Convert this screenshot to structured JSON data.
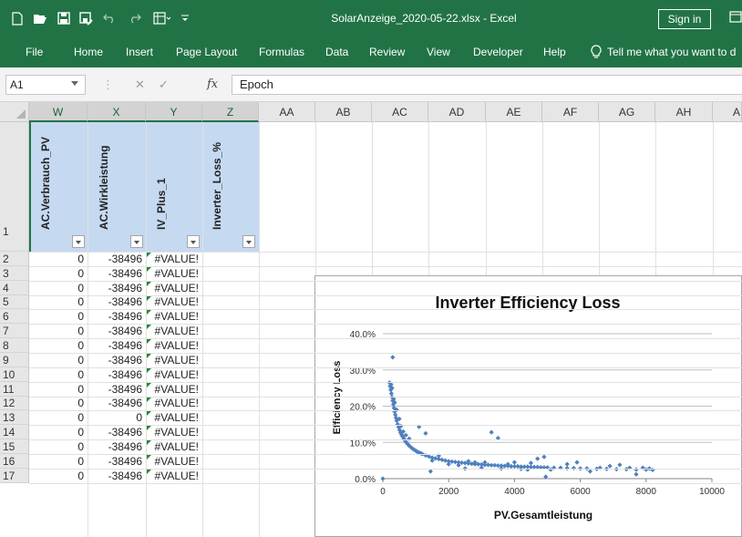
{
  "titlebar": {
    "document_title": "SolarAnzeige_2020-05-22.xlsx - Excel",
    "sign_in_label": "Sign in",
    "quick_access_icons": [
      "new-document-icon",
      "open-folder-icon",
      "save-icon",
      "save-as-icon",
      "undo-icon",
      "redo-icon",
      "form-icon",
      "customize-qat-icon"
    ],
    "colors": {
      "excel_green": "#217346"
    }
  },
  "ribbon": {
    "tabs": [
      "File",
      "Home",
      "Insert",
      "Page Layout",
      "Formulas",
      "Data",
      "Review",
      "View",
      "Developer",
      "Help"
    ],
    "tell_me": "Tell me what you want to d"
  },
  "formula_bar": {
    "name_box": "A1",
    "fx_label": "fx",
    "content": "Epoch"
  },
  "sheet": {
    "columns": [
      "W",
      "X",
      "Y",
      "Z",
      "AA",
      "AB",
      "AC",
      "AD",
      "AE",
      "AF",
      "AG",
      "AH",
      "A"
    ],
    "selected_columns": [
      "W",
      "X",
      "Y",
      "Z"
    ],
    "header_row": {
      "row_number": "1",
      "cells": [
        "AC.Verbrauch_PV",
        "AC.Wirkleistung",
        "IV_Plus_1",
        "Inverter_Loss_%"
      ]
    },
    "rows": [
      {
        "n": "2",
        "w": "0",
        "x": "-38496",
        "y": "#VALUE!"
      },
      {
        "n": "3",
        "w": "0",
        "x": "-38496",
        "y": "#VALUE!"
      },
      {
        "n": "4",
        "w": "0",
        "x": "-38496",
        "y": "#VALUE!"
      },
      {
        "n": "5",
        "w": "0",
        "x": "-38496",
        "y": "#VALUE!"
      },
      {
        "n": "6",
        "w": "0",
        "x": "-38496",
        "y": "#VALUE!"
      },
      {
        "n": "7",
        "w": "0",
        "x": "-38496",
        "y": "#VALUE!"
      },
      {
        "n": "8",
        "w": "0",
        "x": "-38496",
        "y": "#VALUE!"
      },
      {
        "n": "9",
        "w": "0",
        "x": "-38496",
        "y": "#VALUE!"
      },
      {
        "n": "10",
        "w": "0",
        "x": "-38496",
        "y": "#VALUE!"
      },
      {
        "n": "11",
        "w": "0",
        "x": "-38496",
        "y": "#VALUE!"
      },
      {
        "n": "12",
        "w": "0",
        "x": "-38496",
        "y": "#VALUE!"
      },
      {
        "n": "13",
        "w": "0",
        "x": "0",
        "y": "#VALUE!"
      },
      {
        "n": "14",
        "w": "0",
        "x": "-38496",
        "y": "#VALUE!"
      },
      {
        "n": "15",
        "w": "0",
        "x": "-38496",
        "y": "#VALUE!"
      },
      {
        "n": "16",
        "w": "0",
        "x": "-38496",
        "y": "#VALUE!"
      },
      {
        "n": "17",
        "w": "0",
        "x": "-38496",
        "y": "#VALUE!"
      }
    ]
  },
  "chart_data": {
    "type": "scatter",
    "title": "Inverter Efficiency Loss",
    "xlabel": "PV.Gesamtleistung",
    "ylabel": "Efficiency Loss",
    "xlim": [
      0,
      10000
    ],
    "ylim": [
      0,
      0.4
    ],
    "x_ticks": [
      "0",
      "2000",
      "4000",
      "6000",
      "8000",
      "10000"
    ],
    "y_ticks": [
      "0.0%",
      "10.0%",
      "20.0%",
      "30.0%",
      "40.0%"
    ],
    "grid": "horizontal",
    "marker": "diamond",
    "marker_color": "#4f81bd",
    "series": [
      {
        "points": [
          [
            0,
            0.0
          ],
          [
            200,
            0.265
          ],
          [
            220,
            0.255
          ],
          [
            240,
            0.245
          ],
          [
            260,
            0.235
          ],
          [
            280,
            0.225
          ],
          [
            300,
            0.215
          ],
          [
            320,
            0.205
          ],
          [
            340,
            0.195
          ],
          [
            360,
            0.185
          ],
          [
            380,
            0.176
          ],
          [
            400,
            0.168
          ],
          [
            420,
            0.16
          ],
          [
            450,
            0.15
          ],
          [
            480,
            0.142
          ],
          [
            510,
            0.134
          ],
          [
            540,
            0.127
          ],
          [
            570,
            0.121
          ],
          [
            600,
            0.116
          ],
          [
            640,
            0.11
          ],
          [
            680,
            0.104
          ],
          [
            720,
            0.099
          ],
          [
            760,
            0.095
          ],
          [
            800,
            0.091
          ],
          [
            850,
            0.087
          ],
          [
            900,
            0.083
          ],
          [
            950,
            0.08
          ],
          [
            1000,
            0.077
          ],
          [
            1050,
            0.074
          ],
          [
            1100,
            0.072
          ],
          [
            1150,
            0.07
          ],
          [
            1200,
            0.068
          ],
          [
            1300,
            0.064
          ],
          [
            1400,
            0.061
          ],
          [
            1500,
            0.058
          ],
          [
            1600,
            0.056
          ],
          [
            1700,
            0.054
          ],
          [
            1800,
            0.052
          ],
          [
            1900,
            0.05
          ],
          [
            2000,
            0.048
          ],
          [
            2100,
            0.047
          ],
          [
            2200,
            0.046
          ],
          [
            2300,
            0.045
          ],
          [
            2400,
            0.044
          ],
          [
            2500,
            0.043
          ],
          [
            2600,
            0.042
          ],
          [
            2700,
            0.041
          ],
          [
            2800,
            0.04
          ],
          [
            2900,
            0.04
          ],
          [
            3000,
            0.039
          ],
          [
            3100,
            0.038
          ],
          [
            3200,
            0.038
          ],
          [
            3300,
            0.037
          ],
          [
            3400,
            0.037
          ],
          [
            3500,
            0.036
          ],
          [
            3600,
            0.036
          ],
          [
            3700,
            0.035
          ],
          [
            3800,
            0.035
          ],
          [
            3900,
            0.034
          ],
          [
            4000,
            0.034
          ],
          [
            4100,
            0.034
          ],
          [
            4200,
            0.033
          ],
          [
            4300,
            0.033
          ],
          [
            4400,
            0.033
          ],
          [
            4500,
            0.032
          ],
          [
            4600,
            0.032
          ],
          [
            4700,
            0.032
          ],
          [
            4800,
            0.031
          ],
          [
            4900,
            0.031
          ],
          [
            5000,
            0.031
          ],
          [
            5200,
            0.03
          ],
          [
            5400,
            0.03
          ],
          [
            5600,
            0.029
          ],
          [
            5800,
            0.029
          ],
          [
            6000,
            0.028
          ],
          [
            6200,
            0.028
          ],
          [
            6500,
            0.027
          ],
          [
            6800,
            0.027
          ],
          [
            7100,
            0.026
          ],
          [
            7400,
            0.026
          ],
          [
            7700,
            0.025
          ],
          [
            8000,
            0.025
          ],
          [
            8200,
            0.024
          ],
          [
            300,
            0.335
          ],
          [
            250,
            0.26
          ],
          [
            280,
            0.25
          ],
          [
            330,
            0.22
          ],
          [
            360,
            0.21
          ],
          [
            420,
            0.19
          ],
          [
            500,
            0.165
          ],
          [
            550,
            0.145
          ],
          [
            620,
            0.13
          ],
          [
            700,
            0.12
          ],
          [
            800,
            0.11
          ],
          [
            1100,
            0.143
          ],
          [
            1300,
            0.125
          ],
          [
            1500,
            0.05
          ],
          [
            1450,
            0.02
          ],
          [
            1700,
            0.063
          ],
          [
            2000,
            0.04
          ],
          [
            2300,
            0.037
          ],
          [
            2600,
            0.048
          ],
          [
            3000,
            0.03
          ],
          [
            3300,
            0.128
          ],
          [
            3500,
            0.112
          ],
          [
            3800,
            0.04
          ],
          [
            4200,
            0.027
          ],
          [
            4500,
            0.043
          ],
          [
            4700,
            0.055
          ],
          [
            4900,
            0.06
          ],
          [
            4950,
            0.005
          ],
          [
            5100,
            0.025
          ],
          [
            5600,
            0.04
          ],
          [
            5900,
            0.045
          ],
          [
            6300,
            0.02
          ],
          [
            6600,
            0.03
          ],
          [
            6900,
            0.035
          ],
          [
            7200,
            0.038
          ],
          [
            7500,
            0.03
          ],
          [
            7700,
            0.012
          ],
          [
            7900,
            0.03
          ],
          [
            8100,
            0.028
          ],
          [
            2500,
            0.028
          ],
          [
            2800,
            0.045
          ],
          [
            3100,
            0.045
          ],
          [
            3600,
            0.028
          ],
          [
            4000,
            0.045
          ],
          [
            4400,
            0.025
          ]
        ]
      }
    ]
  }
}
